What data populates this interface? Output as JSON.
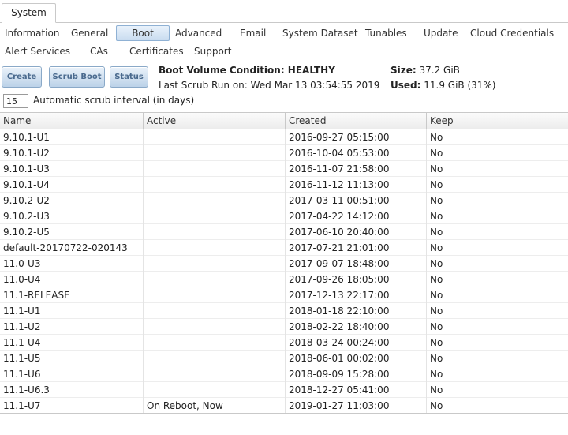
{
  "main_tab": {
    "label": "System"
  },
  "subtabs": [
    {
      "label": "Information"
    },
    {
      "label": "General"
    },
    {
      "label": "Boot"
    },
    {
      "label": "Advanced"
    },
    {
      "label": "Email"
    },
    {
      "label": "System Dataset"
    },
    {
      "label": "Tunables"
    },
    {
      "label": "Update"
    },
    {
      "label": "Cloud Credentials"
    },
    {
      "label": "Alert Services"
    },
    {
      "label": "CAs"
    },
    {
      "label": "Certificates"
    },
    {
      "label": "Support"
    }
  ],
  "buttons": {
    "create": "Create",
    "scrub_boot": "Scrub Boot",
    "status": "Status"
  },
  "boot_info": {
    "condition_label": "Boot Volume Condition: HEALTHY",
    "last_scrub": "Last Scrub Run on: Wed Mar 13 03:54:55 2019",
    "size_label": "Size:",
    "size_value": " 37.2 GiB",
    "used_label": "Used:",
    "used_value": " 11.9 GiB (31%)"
  },
  "scrub_interval": {
    "value": "15",
    "label": "Automatic scrub interval (in days)"
  },
  "table": {
    "headers": [
      "Name",
      "Active",
      "Created",
      "Keep"
    ],
    "rows": [
      [
        "9.10.1-U1",
        "",
        "2016-09-27 05:15:00",
        "No"
      ],
      [
        "9.10.1-U2",
        "",
        "2016-10-04 05:53:00",
        "No"
      ],
      [
        "9.10.1-U3",
        "",
        "2016-11-07 21:58:00",
        "No"
      ],
      [
        "9.10.1-U4",
        "",
        "2016-11-12 11:13:00",
        "No"
      ],
      [
        "9.10.2-U2",
        "",
        "2017-03-11 00:51:00",
        "No"
      ],
      [
        "9.10.2-U3",
        "",
        "2017-04-22 14:12:00",
        "No"
      ],
      [
        "9.10.2-U5",
        "",
        "2017-06-10 20:40:00",
        "No"
      ],
      [
        "default-20170722-020143",
        "",
        "2017-07-21 21:01:00",
        "No"
      ],
      [
        "11.0-U3",
        "",
        "2017-09-07 18:48:00",
        "No"
      ],
      [
        "11.0-U4",
        "",
        "2017-09-26 18:05:00",
        "No"
      ],
      [
        "11.1-RELEASE",
        "",
        "2017-12-13 22:17:00",
        "No"
      ],
      [
        "11.1-U1",
        "",
        "2018-01-18 22:10:00",
        "No"
      ],
      [
        "11.1-U2",
        "",
        "2018-02-22 18:40:00",
        "No"
      ],
      [
        "11.1-U4",
        "",
        "2018-03-24 00:24:00",
        "No"
      ],
      [
        "11.1-U5",
        "",
        "2018-06-01 00:02:00",
        "No"
      ],
      [
        "11.1-U6",
        "",
        "2018-09-09 15:28:00",
        "No"
      ],
      [
        "11.1-U6.3",
        "",
        "2018-12-27 05:41:00",
        "No"
      ],
      [
        "11.1-U7",
        "On Reboot, Now",
        "2019-01-27 11:03:00",
        "No"
      ]
    ]
  }
}
